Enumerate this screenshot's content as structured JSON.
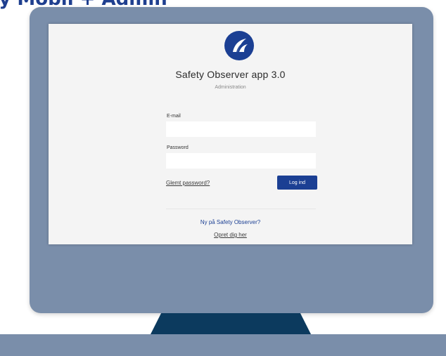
{
  "heading_fragment": "ty Mobil + Admin",
  "app": {
    "logo_icon": "safety-observer-logo",
    "title": "Safety Observer app 3.0",
    "subtitle": "Administration"
  },
  "form": {
    "email_label": "E-mail",
    "email_value": "",
    "password_label": "Password",
    "password_value": "",
    "forgot_label": "Glemt password?",
    "login_label": "Log ind"
  },
  "signup": {
    "prompt": "Ny på Safety Observer?",
    "link_label": "Opret dig her"
  },
  "colors": {
    "brand": "#1b3f93",
    "monitor": "#7a8eaa",
    "stand": "#0c3a5e"
  }
}
